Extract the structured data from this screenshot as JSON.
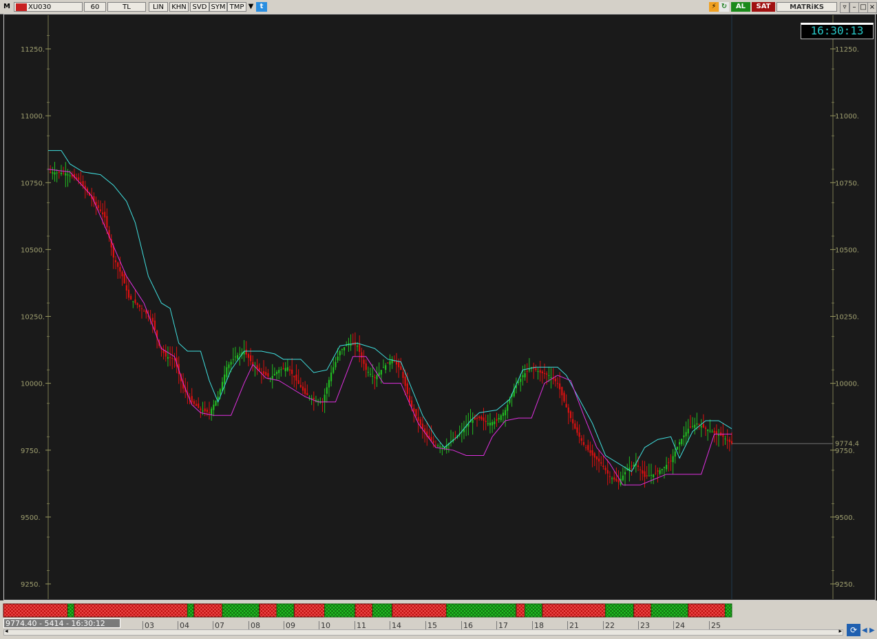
{
  "toolbar": {
    "m_label": "M",
    "symbol": "XU030",
    "period": "60",
    "currency": "TL",
    "buttons": [
      "LIN",
      "KHN",
      "SVD",
      "SYM",
      "TMP"
    ],
    "buy_label": "AL",
    "sell_label": "SAT",
    "brand": "MATRiKS"
  },
  "clock": "16:30:13",
  "status_text": "9774.40 - 5414 - 16:30:12",
  "last_price_label": "9774.4",
  "colors": {
    "background": "#1a1a1a",
    "axis": "#8a8a5a",
    "up_candle": "#22c022",
    "down_candle": "#e01010",
    "upper_band": "#40e0e0",
    "lower_band": "#e030e0",
    "bull_bar": "#22c022",
    "bear_bar": "#c01010"
  },
  "chart_data": {
    "type": "candlestick",
    "symbol": "XU030",
    "interval": "60",
    "ylim": [
      9175,
      11350
    ],
    "y_ticks": [
      "11250.",
      "11000.",
      "10750.",
      "10500.",
      "10250.",
      "10000.",
      "9750.",
      "9500.",
      "9250."
    ],
    "x_ticks": [
      "03",
      "04",
      "07",
      "08",
      "09",
      "10",
      "11",
      "14",
      "15",
      "16",
      "17",
      "18",
      "21",
      "22",
      "23",
      "24",
      "25"
    ],
    "last_price": 9774.4,
    "close_path": [
      [
        0,
        10790
      ],
      [
        8,
        10785
      ],
      [
        14,
        10760
      ],
      [
        20,
        10690
      ],
      [
        26,
        10620
      ],
      [
        30,
        10470
      ],
      [
        34,
        10400
      ],
      [
        37,
        10320
      ],
      [
        40,
        10300
      ],
      [
        44,
        10270
      ],
      [
        48,
        10230
      ],
      [
        51,
        10140
      ],
      [
        54,
        10100
      ],
      [
        58,
        10090
      ],
      [
        62,
        9980
      ],
      [
        66,
        9930
      ],
      [
        70,
        9900
      ],
      [
        74,
        9890
      ],
      [
        78,
        9950
      ],
      [
        82,
        10060
      ],
      [
        86,
        10100
      ],
      [
        90,
        10120
      ],
      [
        94,
        10070
      ],
      [
        98,
        10040
      ],
      [
        102,
        10020
      ],
      [
        106,
        10050
      ],
      [
        110,
        10060
      ],
      [
        114,
        10010
      ],
      [
        118,
        9960
      ],
      [
        122,
        9940
      ],
      [
        126,
        9930
      ],
      [
        130,
        10040
      ],
      [
        134,
        10120
      ],
      [
        138,
        10150
      ],
      [
        142,
        10140
      ],
      [
        146,
        10050
      ],
      [
        150,
        10020
      ],
      [
        154,
        10060
      ],
      [
        158,
        10090
      ],
      [
        162,
        10050
      ],
      [
        166,
        9930
      ],
      [
        170,
        9860
      ],
      [
        174,
        9800
      ],
      [
        178,
        9770
      ],
      [
        182,
        9760
      ],
      [
        186,
        9790
      ],
      [
        190,
        9820
      ],
      [
        194,
        9860
      ],
      [
        198,
        9870
      ],
      [
        202,
        9850
      ],
      [
        206,
        9860
      ],
      [
        210,
        9900
      ],
      [
        214,
        9980
      ],
      [
        218,
        10030
      ],
      [
        222,
        10060
      ],
      [
        226,
        10040
      ],
      [
        230,
        10030
      ],
      [
        234,
        10000
      ],
      [
        238,
        9910
      ],
      [
        242,
        9830
      ],
      [
        246,
        9770
      ],
      [
        250,
        9730
      ],
      [
        254,
        9700
      ],
      [
        258,
        9650
      ],
      [
        262,
        9630
      ],
      [
        266,
        9680
      ],
      [
        270,
        9700
      ],
      [
        274,
        9650
      ],
      [
        278,
        9660
      ],
      [
        282,
        9680
      ],
      [
        286,
        9710
      ],
      [
        290,
        9780
      ],
      [
        294,
        9830
      ],
      [
        298,
        9850
      ],
      [
        302,
        9830
      ],
      [
        306,
        9815
      ],
      [
        310,
        9800
      ],
      [
        314,
        9774
      ]
    ],
    "upper_band_path": [
      [
        0,
        10870
      ],
      [
        6,
        10870
      ],
      [
        10,
        10820
      ],
      [
        16,
        10790
      ],
      [
        24,
        10780
      ],
      [
        30,
        10740
      ],
      [
        36,
        10680
      ],
      [
        40,
        10600
      ],
      [
        46,
        10400
      ],
      [
        52,
        10300
      ],
      [
        56,
        10280
      ],
      [
        60,
        10150
      ],
      [
        64,
        10120
      ],
      [
        70,
        10120
      ],
      [
        74,
        10010
      ],
      [
        78,
        9930
      ],
      [
        84,
        10050
      ],
      [
        90,
        10120
      ],
      [
        98,
        10120
      ],
      [
        104,
        10110
      ],
      [
        108,
        10090
      ],
      [
        116,
        10090
      ],
      [
        122,
        10040
      ],
      [
        128,
        10050
      ],
      [
        134,
        10140
      ],
      [
        142,
        10150
      ],
      [
        150,
        10130
      ],
      [
        156,
        10090
      ],
      [
        162,
        10080
      ],
      [
        166,
        10000
      ],
      [
        172,
        9880
      ],
      [
        178,
        9800
      ],
      [
        182,
        9760
      ],
      [
        188,
        9800
      ],
      [
        194,
        9860
      ],
      [
        198,
        9890
      ],
      [
        206,
        9900
      ],
      [
        212,
        9940
      ],
      [
        218,
        10050
      ],
      [
        224,
        10060
      ],
      [
        234,
        10060
      ],
      [
        238,
        10030
      ],
      [
        244,
        9940
      ],
      [
        250,
        9850
      ],
      [
        256,
        9730
      ],
      [
        262,
        9700
      ],
      [
        268,
        9670
      ],
      [
        274,
        9760
      ],
      [
        280,
        9790
      ],
      [
        286,
        9800
      ],
      [
        290,
        9720
      ],
      [
        296,
        9820
      ],
      [
        302,
        9860
      ],
      [
        308,
        9860
      ],
      [
        314,
        9830
      ]
    ],
    "lower_band_path": [
      [
        0,
        10800
      ],
      [
        10,
        10790
      ],
      [
        20,
        10700
      ],
      [
        28,
        10550
      ],
      [
        36,
        10400
      ],
      [
        44,
        10300
      ],
      [
        52,
        10130
      ],
      [
        58,
        10100
      ],
      [
        62,
        10000
      ],
      [
        66,
        9920
      ],
      [
        70,
        9890
      ],
      [
        76,
        9880
      ],
      [
        84,
        9880
      ],
      [
        90,
        10000
      ],
      [
        94,
        10070
      ],
      [
        100,
        10020
      ],
      [
        106,
        10010
      ],
      [
        110,
        9990
      ],
      [
        118,
        9950
      ],
      [
        124,
        9930
      ],
      [
        132,
        9930
      ],
      [
        140,
        10100
      ],
      [
        146,
        10100
      ],
      [
        154,
        10000
      ],
      [
        162,
        10000
      ],
      [
        170,
        9850
      ],
      [
        178,
        9760
      ],
      [
        186,
        9750
      ],
      [
        192,
        9730
      ],
      [
        200,
        9730
      ],
      [
        204,
        9800
      ],
      [
        210,
        9860
      ],
      [
        216,
        9870
      ],
      [
        222,
        9870
      ],
      [
        228,
        10000
      ],
      [
        234,
        10030
      ],
      [
        240,
        10010
      ],
      [
        246,
        9880
      ],
      [
        252,
        9760
      ],
      [
        258,
        9700
      ],
      [
        264,
        9620
      ],
      [
        272,
        9620
      ],
      [
        278,
        9640
      ],
      [
        284,
        9660
      ],
      [
        292,
        9660
      ],
      [
        300,
        9660
      ],
      [
        306,
        9810
      ],
      [
        314,
        9810
      ]
    ],
    "signal_bar": [
      [
        "bear",
        0,
        9
      ],
      [
        "bull",
        9,
        12
      ],
      [
        "bear",
        12,
        64
      ],
      [
        "bull",
        64,
        67
      ],
      [
        "bear",
        67,
        80
      ],
      [
        "bull",
        80,
        97
      ],
      [
        "bear",
        97,
        105
      ],
      [
        "bull",
        105,
        113
      ],
      [
        "bear",
        113,
        127
      ],
      [
        "bull",
        127,
        141
      ],
      [
        "bear",
        141,
        149
      ],
      [
        "bull",
        149,
        158
      ],
      [
        "bear",
        158,
        183
      ],
      [
        "bull",
        183,
        215
      ],
      [
        "bear",
        215,
        219
      ],
      [
        "bull",
        219,
        227
      ],
      [
        "bear",
        227,
        256
      ],
      [
        "bull",
        256,
        269
      ],
      [
        "bear",
        269,
        277
      ],
      [
        "bull",
        277,
        294
      ],
      [
        "bear",
        294,
        311
      ],
      [
        "bull",
        311,
        314
      ]
    ]
  }
}
